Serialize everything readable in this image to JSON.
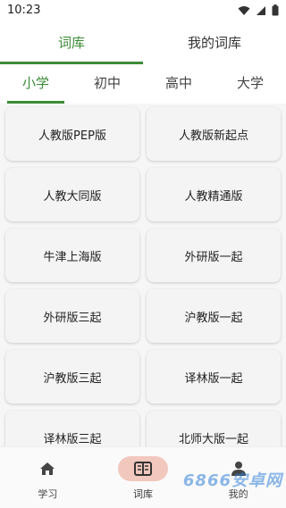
{
  "status": {
    "time": "10:23"
  },
  "top_tabs": [
    {
      "label": "词库",
      "active": true
    },
    {
      "label": "我的词库",
      "active": false
    }
  ],
  "sub_tabs": [
    {
      "label": "小学",
      "active": true
    },
    {
      "label": "初中",
      "active": false
    },
    {
      "label": "高中",
      "active": false
    },
    {
      "label": "大学",
      "active": false
    }
  ],
  "books": [
    "人教版PEP版",
    "人教版新起点",
    "人教大同版",
    "人教精通版",
    "牛津上海版",
    "外研版一起",
    "外研版三起",
    "沪教版一起",
    "沪教版三起",
    "译林版一起",
    "译林版三起",
    "北师大版一起"
  ],
  "bottom_nav": [
    {
      "label": "学习",
      "icon": "home-icon",
      "active": false
    },
    {
      "label": "词库",
      "icon": "book-icon",
      "active": true
    },
    {
      "label": "我的",
      "icon": "person-icon",
      "active": false
    }
  ],
  "watermark": "6866安卓网",
  "colors": {
    "accent": "#3c8b35",
    "active_nav_bg": "#f2c7bd"
  }
}
